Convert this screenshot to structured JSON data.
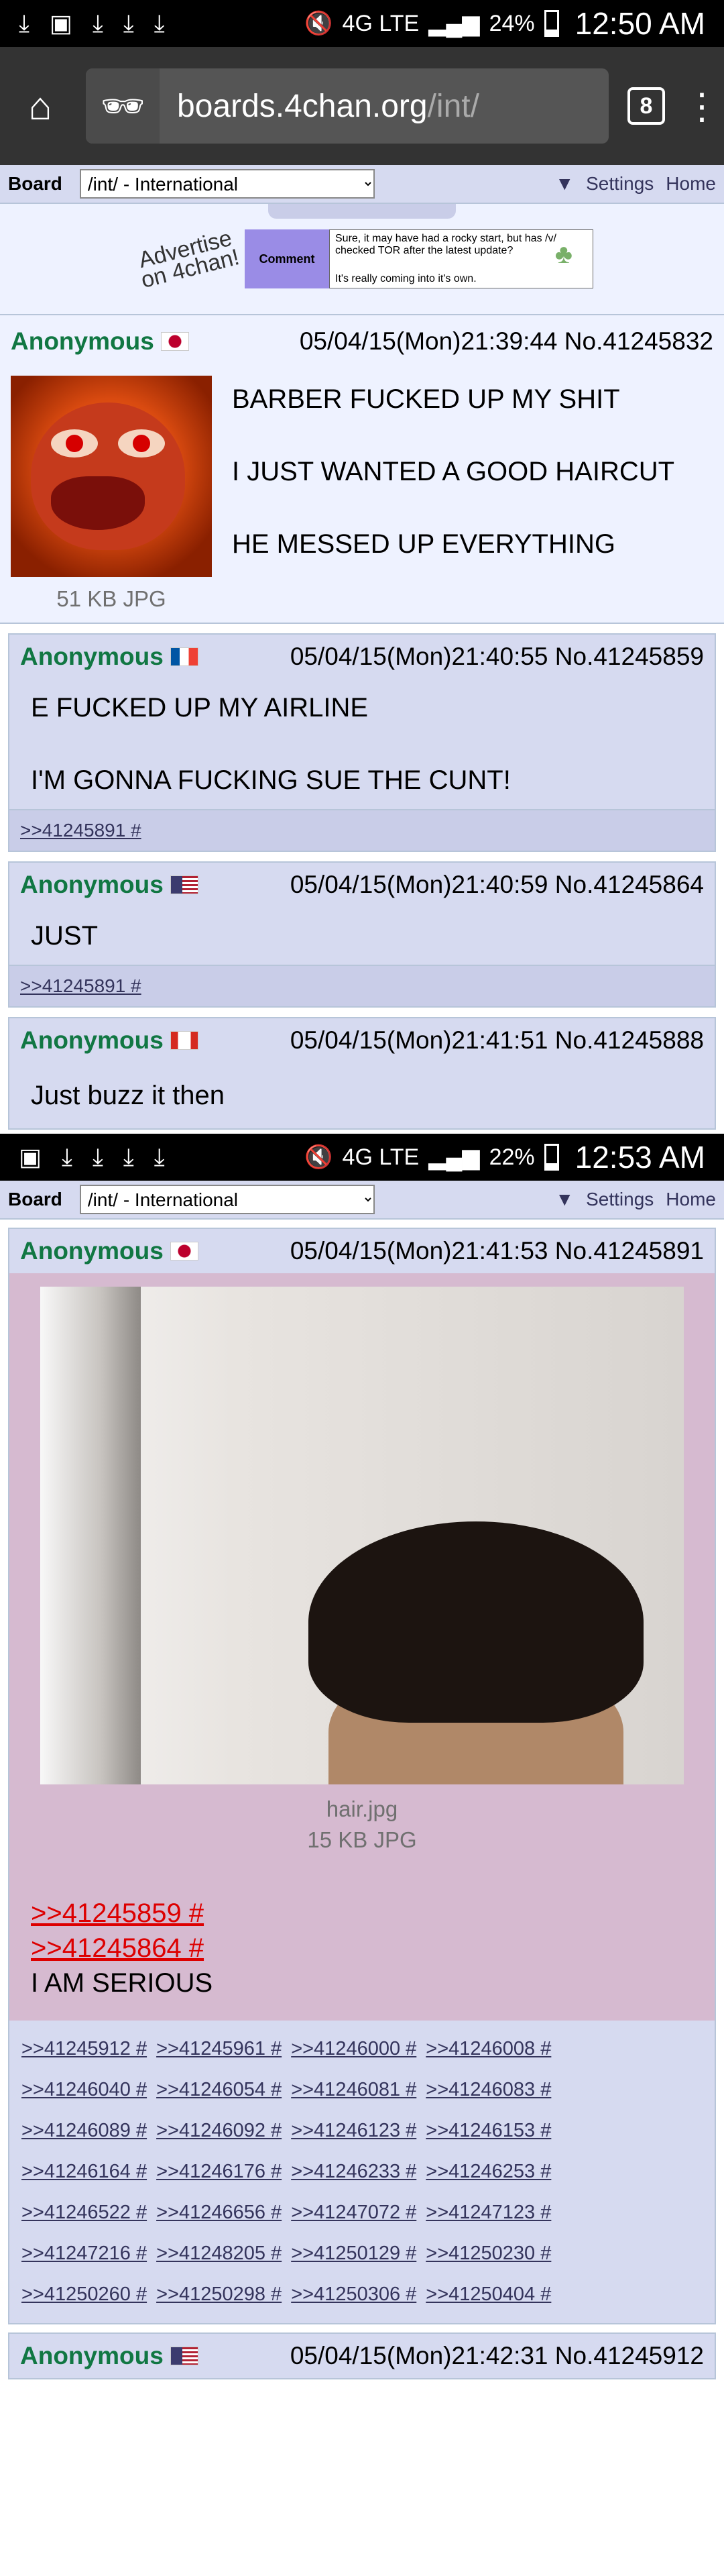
{
  "status1": {
    "time": "12:50 AM",
    "battery": "24%",
    "network": "4G LTE"
  },
  "status2": {
    "time": "12:53 AM",
    "battery": "22%",
    "network": "4G LTE"
  },
  "browser": {
    "url_host": "boards.4chan.org",
    "url_path": "/int/",
    "tab_count": "8"
  },
  "boardbar": {
    "label": "Board",
    "selected": "/int/ - International",
    "settings": "Settings",
    "home": "Home"
  },
  "ad": {
    "headline": "Advertise on 4chan!",
    "comment": "Comment",
    "line1": "Sure, it may have had a rocky start, but has /v/ checked TOR after the latest update?",
    "line2": "It's really coming into it's own."
  },
  "op": {
    "name": "Anonymous",
    "datetime": "05/04/15(Mon)21:39:44 No.41245832",
    "file": "51 KB JPG",
    "lines": [
      "BARBER FUCKED UP MY SHIT",
      "I JUST WANTED A GOOD HAIRCUT",
      "HE MESSED UP EVERYTHING"
    ]
  },
  "posts": [
    {
      "name": "Anonymous",
      "datetime": "05/04/15(Mon)21:40:55 No.41245859",
      "lines": [
        "E FUCKED UP MY AIRLINE",
        "I'M GONNA FUCKING SUE THE CUNT!"
      ],
      "backlinks": ">>41245891 #"
    },
    {
      "name": "Anonymous",
      "datetime": "05/04/15(Mon)21:40:59 No.41245864",
      "lines": [
        "JUST"
      ],
      "backlinks": ">>41245891 #"
    },
    {
      "name": "Anonymous",
      "datetime": "05/04/15(Mon)21:41:51 No.41245888",
      "lines": [
        "Just buzz it then"
      ]
    }
  ],
  "highlighted": {
    "name": "Anonymous",
    "datetime": "05/04/15(Mon)21:41:53 No.41245891",
    "filename": "hair.jpg",
    "filesize": "15 KB JPG",
    "quotes": [
      ">>41245859 #",
      ">>41245864 #"
    ],
    "text": "I AM SERIOUS",
    "backlinks": [
      ">>41245912 #",
      ">>41245961 #",
      ">>41246000 #",
      ">>41246008 #",
      ">>41246040 #",
      ">>41246054 #",
      ">>41246081 #",
      ">>41246083 #",
      ">>41246089 #",
      ">>41246092 #",
      ">>41246123 #",
      ">>41246153 #",
      ">>41246164 #",
      ">>41246176 #",
      ">>41246233 #",
      ">>41246253 #",
      ">>41246522 #",
      ">>41246656 #",
      ">>41247072 #",
      ">>41247123 #",
      ">>41247216 #",
      ">>41248205 #",
      ">>41250129 #",
      ">>41250230 #",
      ">>41250260 #",
      ">>41250298 #",
      ">>41250306 #",
      ">>41250404 #"
    ]
  },
  "last": {
    "name": "Anonymous",
    "datetime": "05/04/15(Mon)21:42:31 No.41245912"
  }
}
